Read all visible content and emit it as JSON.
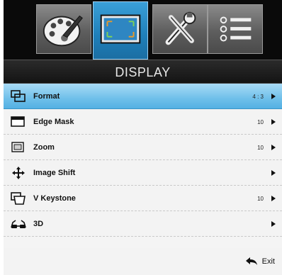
{
  "tabs": [
    {
      "icon": "palette-icon",
      "active": false
    },
    {
      "icon": "display-screen-icon",
      "active": true
    },
    {
      "icon": "tools-icon",
      "active": false
    },
    {
      "icon": "options-list-icon",
      "active": false
    }
  ],
  "header": {
    "title": "DISPLAY"
  },
  "menu": {
    "items": [
      {
        "label": "Format",
        "value": "4 : 3",
        "icon": "format-icon",
        "selected": true
      },
      {
        "label": "Edge Mask",
        "value": "10",
        "icon": "edge-mask-icon",
        "selected": false
      },
      {
        "label": "Zoom",
        "value": "10",
        "icon": "zoom-icon",
        "selected": false
      },
      {
        "label": "Image Shift",
        "value": "",
        "icon": "image-shift-icon",
        "selected": false
      },
      {
        "label": "V Keystone",
        "value": "10",
        "icon": "keystone-icon",
        "selected": false
      },
      {
        "label": "3D",
        "value": "",
        "icon": "3d-glasses-icon",
        "selected": false
      }
    ],
    "exit_label": "Exit"
  },
  "colors": {
    "accent": "#53b0e3",
    "tab_active": "#1f7fb9",
    "background": "#000000"
  }
}
